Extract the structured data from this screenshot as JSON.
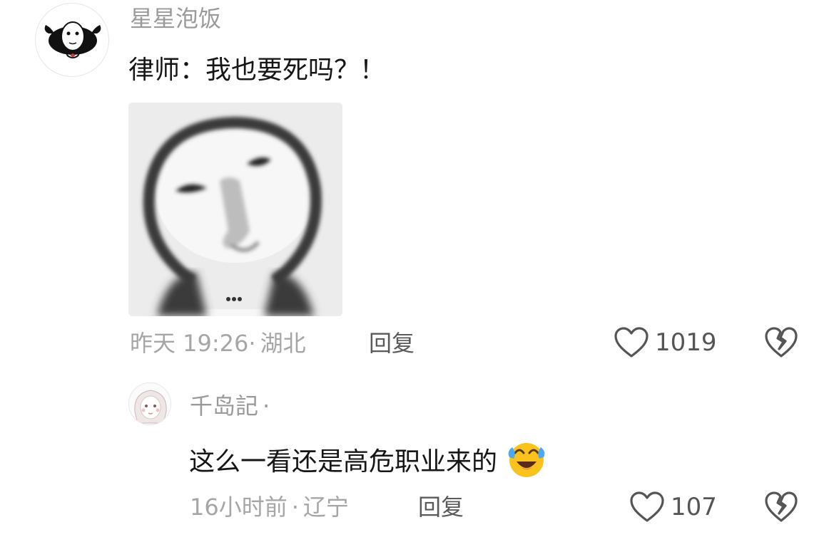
{
  "comments": [
    {
      "username": "星星泡饭",
      "text": "律师：我也要死吗？！",
      "timestamp": "昨天 19:26",
      "location_sep": "·",
      "location": "湖北",
      "reply_label": "回复",
      "likes": "1019",
      "has_sticker": true,
      "replies": [
        {
          "username": "千岛記",
          "username_suffix": "·",
          "text": "这么一看还是高危职业来的",
          "emoji": "crying-laughing-emoji",
          "timestamp": "16小时前",
          "location_sep": "·",
          "location": "辽宁",
          "reply_label": "回复",
          "likes": "107"
        }
      ]
    }
  ],
  "icons": {
    "like": "heart-outline-icon",
    "dislike": "broken-heart-icon"
  },
  "colors": {
    "username": "#9a9a9a",
    "meta": "#a6a6a6",
    "text": "#161616",
    "reply": "#5a5a5a"
  }
}
